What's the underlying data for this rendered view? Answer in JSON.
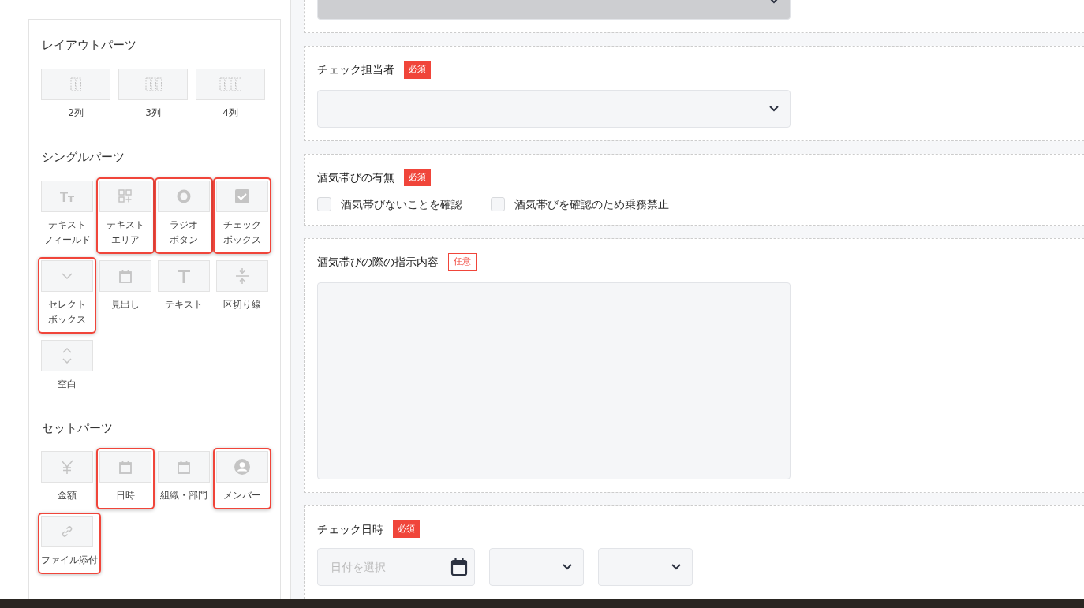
{
  "palette": {
    "sections": [
      {
        "title": "レイアウトパーツ",
        "items": [
          {
            "kind": "cols2",
            "label": "2列",
            "highlighted": false
          },
          {
            "kind": "cols3",
            "label": "3列",
            "highlighted": false
          },
          {
            "kind": "cols4",
            "label": "4列",
            "highlighted": false
          }
        ]
      },
      {
        "title": "シングルパーツ",
        "items": [
          {
            "kind": "textfield",
            "label": [
              "テキスト",
              "フィールド"
            ],
            "highlighted": false
          },
          {
            "kind": "textarea",
            "label": [
              "テキスト",
              "エリア"
            ],
            "highlighted": true
          },
          {
            "kind": "radio",
            "label": [
              "ラジオ",
              "ボタン"
            ],
            "highlighted": true
          },
          {
            "kind": "checkbox",
            "label": [
              "チェック",
              "ボックス"
            ],
            "highlighted": true
          },
          {
            "kind": "select",
            "label": [
              "セレクト",
              "ボックス"
            ],
            "highlighted": true
          },
          {
            "kind": "heading",
            "label": "見出し",
            "highlighted": false
          },
          {
            "kind": "text",
            "label": "テキスト",
            "highlighted": false
          },
          {
            "kind": "divider",
            "label": "区切り線",
            "highlighted": false
          },
          {
            "kind": "spacer",
            "label": "空白",
            "highlighted": false
          }
        ]
      },
      {
        "title": "セットパーツ",
        "items": [
          {
            "kind": "amount",
            "label": "金額",
            "highlighted": false
          },
          {
            "kind": "datetime",
            "label": "日時",
            "highlighted": true
          },
          {
            "kind": "organization",
            "label": "組織・部門",
            "highlighted": false
          },
          {
            "kind": "member",
            "label": "メンバー",
            "highlighted": true
          },
          {
            "kind": "attachment",
            "label": "ファイル添付",
            "highlighted": true
          }
        ]
      }
    ]
  },
  "form": {
    "fields": [
      {
        "kind": "select",
        "disabled": true
      },
      {
        "kind": "select",
        "label": "チェック担当者",
        "required": true,
        "badge": "必須",
        "disabled": false
      },
      {
        "kind": "checkboxes",
        "label": "酒気帯びの有無",
        "required": true,
        "badge": "必須",
        "options": [
          {
            "label": "酒気帯びないことを確認",
            "checked": false
          },
          {
            "label": "酒気帯びを確認のため乗務禁止",
            "checked": false
          }
        ]
      },
      {
        "kind": "textarea",
        "label": "酒気帯びの際の指示内容",
        "required": false,
        "badge": "任意"
      },
      {
        "kind": "datetime",
        "label": "チェック日時",
        "required": true,
        "badge": "必須",
        "placeholder": "日付を選択"
      }
    ]
  }
}
